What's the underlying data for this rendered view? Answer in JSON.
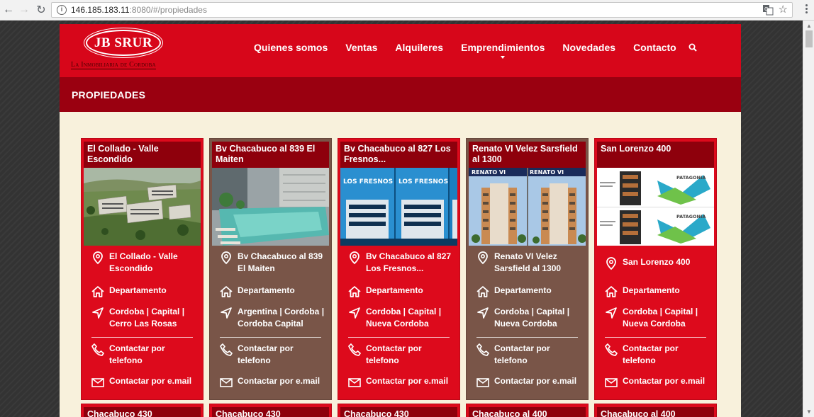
{
  "browser": {
    "url_host": "146.185.183.11",
    "url_path": ":8080/#/propiedades"
  },
  "site": {
    "logo": "JB SRUR",
    "logo_sub": "La Inmobiliaria de Cordoba",
    "nav": [
      "Quienes somos",
      "Ventas",
      "Alquileres",
      "Emprendimientos",
      "Novedades",
      "Contacto"
    ],
    "section_title": "PROPIEDADES"
  },
  "cards": [
    {
      "title": "El Collado - Valle Escondido",
      "name": "El Collado - Valle Escondido",
      "type": "Departamento",
      "location": "Cordoba | Capital | Cerro Las Rosas",
      "phone": "Contactar por telefono",
      "email": "Contactar por e.mail"
    },
    {
      "title": "Bv Chacabuco al 839 El Maiten",
      "name": "Bv Chacabuco al 839 El Maiten",
      "type": "Departamento",
      "location": "Argentina | Cordoba | Cordoba Capital",
      "phone": "Contactar por telefono",
      "email": "Contactar por e.mail"
    },
    {
      "title": "Bv Chacabuco al 827 Los Fresnos...",
      "name": "Bv Chacabuco al 827 Los Fresnos...",
      "type": "Departamento",
      "location": "Cordoba | Capital | Nueva Cordoba",
      "phone": "Contactar por telefono",
      "email": "Contactar por e.mail"
    },
    {
      "title": "Renato VI Velez Sarsfield al 1300",
      "name": "Renato VI Velez Sarsfield al 1300",
      "type": "Departamento",
      "location": "Cordoba | Capital | Nueva Cordoba",
      "phone": "Contactar por telefono",
      "email": "Contactar por e.mail"
    },
    {
      "title": "San Lorenzo 400",
      "name": "San Lorenzo 400",
      "type": "Departamento",
      "location": "Cordoba | Capital | Nueva Cordoba",
      "phone": "Contactar por telefono",
      "email": "Contactar por e.mail"
    }
  ],
  "next_row": [
    "Chacabuco 430",
    "Chacabuco 430",
    "Chacabuco 430",
    "Chacabuco al 400",
    "Chacabuco al 400"
  ],
  "image_labels": {
    "los_fresnos": "LOS FRESNOS",
    "renato": "RENATO VI",
    "patagonia": "PATAGONIA"
  },
  "colors": {
    "red": "#dd0a1c",
    "dark_red": "#8e000c",
    "brown": "#795548",
    "cream": "#f8f1dc"
  }
}
